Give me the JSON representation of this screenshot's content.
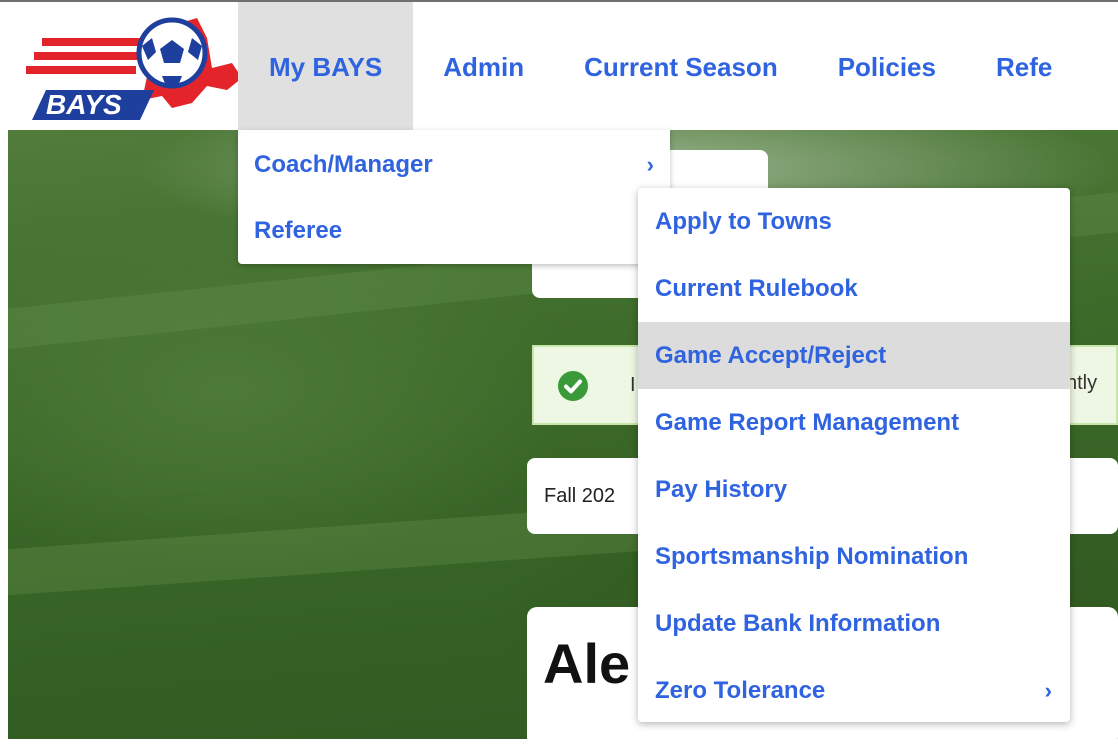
{
  "logo": {
    "text": "BAYS"
  },
  "nav": [
    {
      "label": "My BAYS"
    },
    {
      "label": "Admin"
    },
    {
      "label": "Current Season"
    },
    {
      "label": "Policies"
    },
    {
      "label": "Refe"
    }
  ],
  "dropdown": {
    "items": [
      {
        "label": "Coach/Manager",
        "chevron": "›"
      },
      {
        "label": "Referee"
      }
    ]
  },
  "submenu": {
    "items": [
      {
        "label": "Apply to Towns"
      },
      {
        "label": "Current Rulebook"
      },
      {
        "label": "Game Accept/Reject"
      },
      {
        "label": "Game Report Management"
      },
      {
        "label": "Pay History"
      },
      {
        "label": "Sportsmanship Nomination"
      },
      {
        "label": "Update Bank Information"
      },
      {
        "label": "Zero Tolerance",
        "chevron": "›"
      }
    ]
  },
  "alert": {
    "text_start": "I",
    "text_end": "ntly"
  },
  "season": {
    "text": "Fall 202"
  },
  "name": {
    "text": "Ale"
  },
  "colors": {
    "link": "#2f63e0",
    "nav_active_bg": "#e0e0e0",
    "alert_bg": "#eef7e3",
    "logo_red": "#e3242b",
    "logo_blue": "#1f3f9e"
  }
}
